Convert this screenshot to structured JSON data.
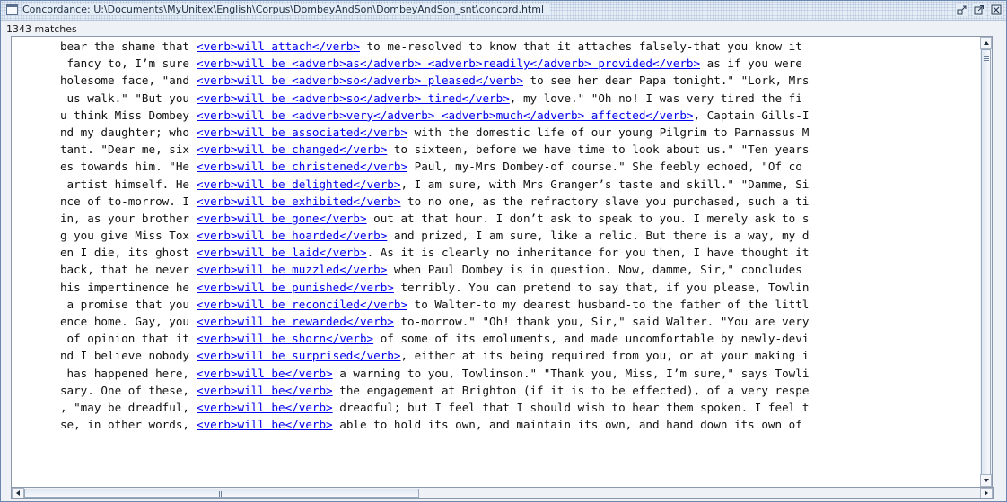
{
  "window": {
    "title": "Concordance: U:\\Documents\\MyUnitex\\English\\Corpus\\DombeyAndSon\\DombeyAndSon_snt\\concord.html",
    "icons": [
      "window-icon",
      "iconify-icon",
      "maximize-icon",
      "close-icon"
    ]
  },
  "status": {
    "match_count": "1343 matches"
  },
  "colors": {
    "link": "#0000ee",
    "frame": "#6a87b0",
    "titlebar": "#e4ecf6"
  },
  "lines": [
    {
      "left": "bear the shame that",
      "match": "<verb>will attach</verb>",
      "right": " to me-resolved to know that it attaches falsely-that you know it"
    },
    {
      "left": "fancy to, I’m sure",
      "match": "<verb>will be <adverb>as</adverb> <adverb>readily</adverb> provided</verb>",
      "right": " as if you were"
    },
    {
      "left": "holesome face, \"and",
      "match": "<verb>will be <adverb>so</adverb> pleased</verb>",
      "right": " to see her dear Papa tonight.\" \"Lork, Mrs"
    },
    {
      "left": "us walk.\" \"But you",
      "match": "<verb>will be <adverb>so</adverb> tired</verb>",
      "right": ", my love.\" \"Oh no! I was very tired the fi"
    },
    {
      "left": "u think Miss Dombey",
      "match": "<verb>will be <adverb>very</adverb> <adverb>much</adverb> affected</verb>",
      "right": ", Captain Gills-I"
    },
    {
      "left": "nd my daughter; who",
      "match": "<verb>will be associated</verb>",
      "right": " with the domestic life of our young Pilgrim to Parnassus M"
    },
    {
      "left": "tant. \"Dear me, six",
      "match": "<verb>will be changed</verb>",
      "right": " to sixteen, before we have time to look about us.\" \"Ten years"
    },
    {
      "left": "es towards him. \"He",
      "match": "<verb>will be christened</verb>",
      "right": " Paul, my-Mrs Dombey-of course.\" She feebly echoed, \"Of co"
    },
    {
      "left": "artist himself. He",
      "match": "<verb>will be delighted</verb>",
      "right": ", I am sure, with Mrs Granger’s taste and skill.\" \"Damme, Si"
    },
    {
      "left": "nce of to-morrow. I",
      "match": "<verb>will be exhibited</verb>",
      "right": " to no one, as the refractory slave you purchased, such a ti"
    },
    {
      "left": "in, as your brother",
      "match": "<verb>will be gone</verb>",
      "right": " out at that hour. I don’t ask to speak to you. I merely ask to s"
    },
    {
      "left": "g you give Miss Tox",
      "match": "<verb>will be hoarded</verb>",
      "right": " and prized, I am sure, like a relic. But there is a way, my d"
    },
    {
      "left": "en I die, its ghost",
      "match": "<verb>will be laid</verb>",
      "right": ". As it is clearly no inheritance for you then, I have thought it"
    },
    {
      "left": "back, that he never",
      "match": "<verb>will be muzzled</verb>",
      "right": " when Paul Dombey is in question. Now, damme, Sir,\" concludes"
    },
    {
      "left": "his impertinence he",
      "match": "<verb>will be punished</verb>",
      "right": " terribly. You can pretend to say that, if you please, Towlin"
    },
    {
      "left": "a promise that you",
      "match": "<verb>will be reconciled</verb>",
      "right": " to Walter-to my dearest husband-to the father of the littl"
    },
    {
      "left": "ence home. Gay, you",
      "match": "<verb>will be rewarded</verb>",
      "right": " to-morrow.\" \"Oh! thank you, Sir,\" said Walter. \"You are very"
    },
    {
      "left": "of opinion that it",
      "match": "<verb>will be shorn</verb>",
      "right": " of some of its emoluments, and made uncomfortable by newly-devi"
    },
    {
      "left": "nd I believe nobody",
      "match": "<verb>will be surprised</verb>",
      "right": ", either at its being required from you, or at your making i"
    },
    {
      "left": "has happened here,",
      "match": "<verb>will be</verb>",
      "right": " a warning to you, Towlinson.\" \"Thank you, Miss, I’m sure,\" says Towli"
    },
    {
      "left": "sary. One of these,",
      "match": "<verb>will be</verb>",
      "right": " the engagement at Brighton (if it is to be effected), of a very respe"
    },
    {
      "left": ", \"may be dreadful,",
      "match": "<verb>will be</verb>",
      "right": " dreadful; but I feel that I should wish to hear them spoken. I feel t"
    },
    {
      "left": "se, in other words,",
      "match": "<verb>will be</verb>",
      "right": " able to hold its own, and maintain its own, and hand down its own of"
    },
    {
      "left": "",
      "match": "",
      "right": ""
    }
  ]
}
